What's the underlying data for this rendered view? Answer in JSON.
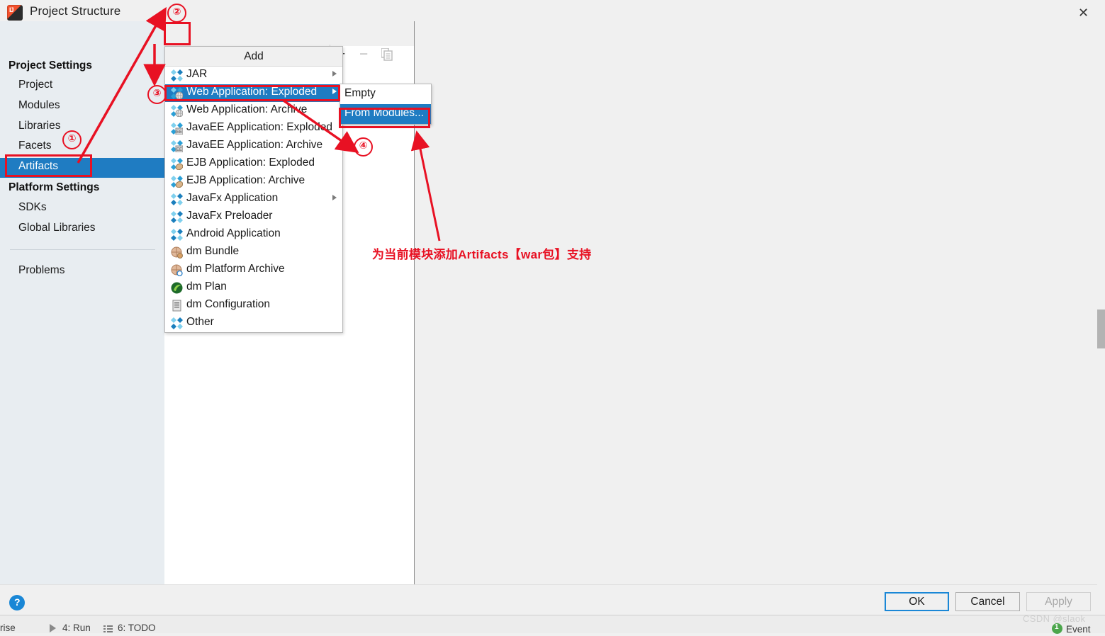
{
  "window": {
    "title": "Project Structure",
    "logo_icon": "intellij-idea-logo",
    "close_icon": "✕"
  },
  "nav": {
    "back_icon": "←",
    "forward_icon": "→"
  },
  "sidebar": {
    "group_project_settings": "Project Settings",
    "group_platform_settings": "Platform Settings",
    "project_items": [
      {
        "label": "Project",
        "selected": false
      },
      {
        "label": "Modules",
        "selected": false
      },
      {
        "label": "Libraries",
        "selected": false
      },
      {
        "label": "Facets",
        "selected": false
      },
      {
        "label": "Artifacts",
        "selected": true
      }
    ],
    "platform_items": [
      {
        "label": "SDKs",
        "selected": false
      },
      {
        "label": "Global Libraries",
        "selected": false
      }
    ],
    "problems_item": {
      "label": "Problems",
      "selected": false
    }
  },
  "toolbar": {
    "add_label": "+",
    "remove_label": "−",
    "copy_icon": "copy-icon"
  },
  "add_menu": {
    "title": "Add",
    "items": [
      {
        "label": "JAR",
        "icon": "jar-icon",
        "has_submenu": true,
        "selected": false
      },
      {
        "label": "Web Application: Exploded",
        "icon": "web-app-icon",
        "has_submenu": true,
        "selected": true
      },
      {
        "label": "Web Application: Archive",
        "icon": "web-app-icon",
        "has_submenu": false,
        "selected": false
      },
      {
        "label": "JavaEE Application: Exploded",
        "icon": "javaee-icon",
        "has_submenu": false,
        "selected": false
      },
      {
        "label": "JavaEE Application: Archive",
        "icon": "javaee-icon",
        "has_submenu": false,
        "selected": false
      },
      {
        "label": "EJB Application: Exploded",
        "icon": "ejb-icon",
        "has_submenu": false,
        "selected": false
      },
      {
        "label": "EJB Application: Archive",
        "icon": "ejb-icon",
        "has_submenu": false,
        "selected": false
      },
      {
        "label": "JavaFx Application",
        "icon": "javafx-icon",
        "has_submenu": true,
        "selected": false
      },
      {
        "label": "JavaFx Preloader",
        "icon": "javafx-icon",
        "has_submenu": false,
        "selected": false
      },
      {
        "label": "Android Application",
        "icon": "android-icon",
        "has_submenu": false,
        "selected": false
      },
      {
        "label": "dm Bundle",
        "icon": "dm-bundle-icon",
        "has_submenu": false,
        "selected": false
      },
      {
        "label": "dm Platform Archive",
        "icon": "dm-platform-icon",
        "has_submenu": false,
        "selected": false
      },
      {
        "label": "dm Plan",
        "icon": "dm-plan-icon",
        "has_submenu": false,
        "selected": false
      },
      {
        "label": "dm Configuration",
        "icon": "dm-config-icon",
        "has_submenu": false,
        "selected": false
      },
      {
        "label": "Other",
        "icon": "other-icon",
        "has_submenu": false,
        "selected": false
      }
    ]
  },
  "sub_menu": {
    "items": [
      {
        "label": "Empty",
        "selected": false
      },
      {
        "label": "From Modules...",
        "selected": true
      }
    ]
  },
  "annotations": {
    "accent_color": "#e81123",
    "marker_1": "①",
    "marker_2": "②",
    "marker_3": "③",
    "marker_4": "④",
    "note_text": "为当前模块添加Artifacts【war包】支持"
  },
  "footer": {
    "help_label": "?",
    "ok_label": "OK",
    "cancel_label": "Cancel",
    "apply_label": "Apply"
  },
  "statusbar": {
    "enterprise_text": "rprise",
    "run_text": "4: Run",
    "todo_text": "6: TODO",
    "event_count": "1",
    "event_text": "Event",
    "watermark": "CSDN @slaok"
  },
  "colors": {
    "selection_blue": "#1f7cc2",
    "annotation_red": "#e81123",
    "sidebar_bg": "#e8edf1",
    "chrome_bg": "#f0f0f0"
  }
}
